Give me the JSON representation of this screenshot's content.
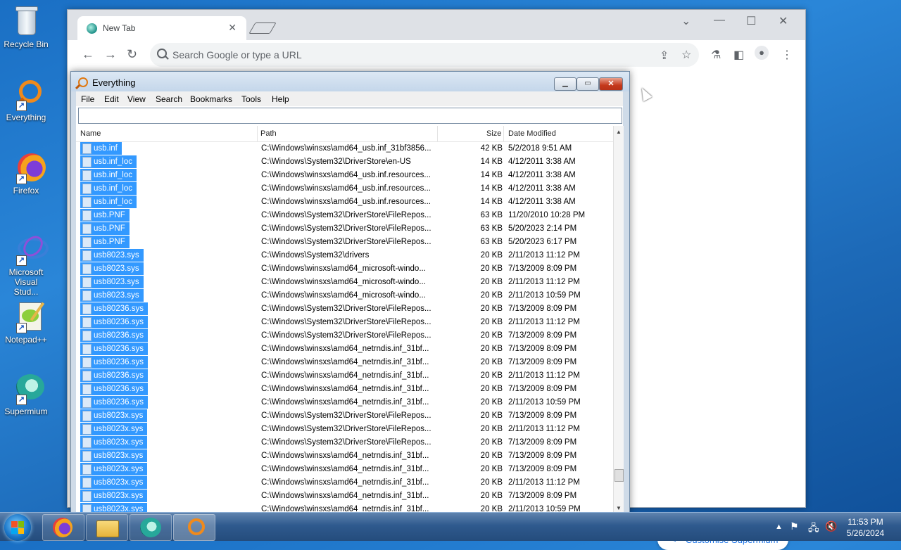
{
  "desktop": {
    "icons": [
      {
        "label": "Recycle Bin"
      },
      {
        "label": "Everything"
      },
      {
        "label": "Firefox"
      },
      {
        "label": "Microsoft Visual Stud..."
      },
      {
        "label": "Notepad++"
      },
      {
        "label": "Supermium"
      }
    ]
  },
  "browser": {
    "tab_title": "New Tab",
    "omnibox_placeholder": "Search Google or type a URL",
    "customise_label": "Customise Supermium"
  },
  "everything": {
    "title": "Everything",
    "menu": [
      "File",
      "Edit",
      "View",
      "Search",
      "Bookmarks",
      "Tools",
      "Help"
    ],
    "search_value": "",
    "columns": {
      "name": "Name",
      "path": "Path",
      "size": "Size",
      "date": "Date Modified"
    },
    "rows": [
      {
        "name": "usb.inf",
        "path": "C:\\Windows\\winsxs\\amd64_usb.inf_31bf3856...",
        "size": "42 KB",
        "date": "5/2/2018 9:51 AM"
      },
      {
        "name": "usb.inf_loc",
        "path": "C:\\Windows\\System32\\DriverStore\\en-US",
        "size": "14 KB",
        "date": "4/12/2011 3:38 AM"
      },
      {
        "name": "usb.inf_loc",
        "path": "C:\\Windows\\winsxs\\amd64_usb.inf.resources...",
        "size": "14 KB",
        "date": "4/12/2011 3:38 AM"
      },
      {
        "name": "usb.inf_loc",
        "path": "C:\\Windows\\winsxs\\amd64_usb.inf.resources...",
        "size": "14 KB",
        "date": "4/12/2011 3:38 AM"
      },
      {
        "name": "usb.inf_loc",
        "path": "C:\\Windows\\winsxs\\amd64_usb.inf.resources...",
        "size": "14 KB",
        "date": "4/12/2011 3:38 AM"
      },
      {
        "name": "usb.PNF",
        "path": "C:\\Windows\\System32\\DriverStore\\FileRepos...",
        "size": "63 KB",
        "date": "11/20/2010 10:28 PM"
      },
      {
        "name": "usb.PNF",
        "path": "C:\\Windows\\System32\\DriverStore\\FileRepos...",
        "size": "63 KB",
        "date": "5/20/2023 2:14 PM"
      },
      {
        "name": "usb.PNF",
        "path": "C:\\Windows\\System32\\DriverStore\\FileRepos...",
        "size": "63 KB",
        "date": "5/20/2023 6:17 PM"
      },
      {
        "name": "usb8023.sys",
        "path": "C:\\Windows\\System32\\drivers",
        "size": "20 KB",
        "date": "2/11/2013 11:12 PM"
      },
      {
        "name": "usb8023.sys",
        "path": "C:\\Windows\\winsxs\\amd64_microsoft-windo...",
        "size": "20 KB",
        "date": "7/13/2009 8:09 PM"
      },
      {
        "name": "usb8023.sys",
        "path": "C:\\Windows\\winsxs\\amd64_microsoft-windo...",
        "size": "20 KB",
        "date": "2/11/2013 11:12 PM"
      },
      {
        "name": "usb8023.sys",
        "path": "C:\\Windows\\winsxs\\amd64_microsoft-windo...",
        "size": "20 KB",
        "date": "2/11/2013 10:59 PM"
      },
      {
        "name": "usb80236.sys",
        "path": "C:\\Windows\\System32\\DriverStore\\FileRepos...",
        "size": "20 KB",
        "date": "7/13/2009 8:09 PM"
      },
      {
        "name": "usb80236.sys",
        "path": "C:\\Windows\\System32\\DriverStore\\FileRepos...",
        "size": "20 KB",
        "date": "2/11/2013 11:12 PM"
      },
      {
        "name": "usb80236.sys",
        "path": "C:\\Windows\\System32\\DriverStore\\FileRepos...",
        "size": "20 KB",
        "date": "7/13/2009 8:09 PM"
      },
      {
        "name": "usb80236.sys",
        "path": "C:\\Windows\\winsxs\\amd64_netrndis.inf_31bf...",
        "size": "20 KB",
        "date": "7/13/2009 8:09 PM"
      },
      {
        "name": "usb80236.sys",
        "path": "C:\\Windows\\winsxs\\amd64_netrndis.inf_31bf...",
        "size": "20 KB",
        "date": "7/13/2009 8:09 PM"
      },
      {
        "name": "usb80236.sys",
        "path": "C:\\Windows\\winsxs\\amd64_netrndis.inf_31bf...",
        "size": "20 KB",
        "date": "2/11/2013 11:12 PM"
      },
      {
        "name": "usb80236.sys",
        "path": "C:\\Windows\\winsxs\\amd64_netrndis.inf_31bf...",
        "size": "20 KB",
        "date": "7/13/2009 8:09 PM"
      },
      {
        "name": "usb80236.sys",
        "path": "C:\\Windows\\winsxs\\amd64_netrndis.inf_31bf...",
        "size": "20 KB",
        "date": "2/11/2013 10:59 PM"
      },
      {
        "name": "usb8023x.sys",
        "path": "C:\\Windows\\System32\\DriverStore\\FileRepos...",
        "size": "20 KB",
        "date": "7/13/2009 8:09 PM"
      },
      {
        "name": "usb8023x.sys",
        "path": "C:\\Windows\\System32\\DriverStore\\FileRepos...",
        "size": "20 KB",
        "date": "2/11/2013 11:12 PM"
      },
      {
        "name": "usb8023x.sys",
        "path": "C:\\Windows\\System32\\DriverStore\\FileRepos...",
        "size": "20 KB",
        "date": "7/13/2009 8:09 PM"
      },
      {
        "name": "usb8023x.sys",
        "path": "C:\\Windows\\winsxs\\amd64_netrndis.inf_31bf...",
        "size": "20 KB",
        "date": "7/13/2009 8:09 PM"
      },
      {
        "name": "usb8023x.sys",
        "path": "C:\\Windows\\winsxs\\amd64_netrndis.inf_31bf...",
        "size": "20 KB",
        "date": "7/13/2009 8:09 PM"
      },
      {
        "name": "usb8023x.sys",
        "path": "C:\\Windows\\winsxs\\amd64_netrndis.inf_31bf...",
        "size": "20 KB",
        "date": "2/11/2013 11:12 PM"
      },
      {
        "name": "usb8023x.sys",
        "path": "C:\\Windows\\winsxs\\amd64_netrndis.inf_31bf...",
        "size": "20 KB",
        "date": "7/13/2009 8:09 PM"
      },
      {
        "name": "usb8023x.sys",
        "path": "C:\\Windows\\winsxs\\amd64_netrndis.inf_31bf...",
        "size": "20 KB",
        "date": "2/11/2013 10:59 PM"
      }
    ]
  },
  "taskbar": {
    "time": "11:53 PM",
    "date": "5/26/2024",
    "apps": [
      "Firefox",
      "File Explorer",
      "Supermium",
      "Everything"
    ]
  },
  "colors": {
    "selection": "#3399ff",
    "chrome_accent": "#1a73e8"
  }
}
